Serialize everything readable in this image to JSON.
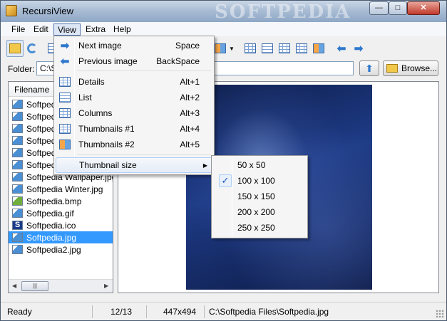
{
  "window": {
    "title": "RecursiView",
    "watermark": "SOFTPEDIA",
    "controls": {
      "minimize": "—",
      "maximize": "□",
      "close": "✕"
    }
  },
  "menubar": [
    "File",
    "Edit",
    "View",
    "Extra",
    "Help"
  ],
  "toolbar": {
    "icons": [
      "folders-icon",
      "refresh-icon",
      "thumbnail-view-icon",
      "view-options-dropdown-icon",
      "details-view-icon",
      "list-view-icon",
      "columns-view-icon",
      "thumbnails1-view-icon",
      "thumbnails2-view-icon",
      "back-arrow-icon",
      "forward-arrow-icon"
    ]
  },
  "folder": {
    "label": "Folder:",
    "value": "C:\\Softpedia Files",
    "browse_label": "Browse..."
  },
  "file_list": {
    "header": "Filename",
    "rows": [
      {
        "name": "Softpedia",
        "type": "image"
      },
      {
        "name": "Softpedia",
        "type": "image"
      },
      {
        "name": "Softpedia",
        "type": "image"
      },
      {
        "name": "Softpedia",
        "type": "image"
      },
      {
        "name": "Softpedia",
        "type": "image"
      },
      {
        "name": "Softpedia",
        "type": "image"
      },
      {
        "name": "Softpedia Wallpaper.jpg",
        "type": "image"
      },
      {
        "name": "Softpedia Winter.jpg",
        "type": "image"
      },
      {
        "name": "Softpedia.bmp",
        "type": "bmp"
      },
      {
        "name": "Softpedia.gif",
        "type": "image"
      },
      {
        "name": "Softpedia.ico",
        "type": "ico"
      },
      {
        "name": "Softpedia.jpg",
        "type": "image",
        "selected": true
      },
      {
        "name": "Softpedia2.jpg",
        "type": "image"
      }
    ],
    "ico_glyph": "S"
  },
  "view_menu": {
    "items": [
      {
        "label": "Next image",
        "shortcut": "Space",
        "icon": "arrow-right-icon"
      },
      {
        "label": "Previous image",
        "shortcut": "BackSpace",
        "icon": "arrow-left-icon"
      },
      {
        "label": "Details",
        "shortcut": "Alt+1",
        "icon": "details-view-icon"
      },
      {
        "label": "List",
        "shortcut": "Alt+2",
        "icon": "list-view-icon"
      },
      {
        "label": "Columns",
        "shortcut": "Alt+3",
        "icon": "columns-view-icon"
      },
      {
        "label": "Thumbnails #1",
        "shortcut": "Alt+4",
        "icon": "thumbnails1-view-icon"
      },
      {
        "label": "Thumbnails #2",
        "shortcut": "Alt+5",
        "icon": "thumbnails2-view-icon"
      },
      {
        "label": "Thumbnail size",
        "shortcut": "",
        "icon": ""
      }
    ]
  },
  "thumbnail_size_menu": {
    "items": [
      "50 x 50",
      "100 x 100",
      "150 x 150",
      "200 x 200",
      "250 x 250"
    ],
    "checked_index": 1,
    "check_glyph": "✓"
  },
  "statusbar": {
    "status": "Ready",
    "position": "12/13",
    "dimensions": "447x494",
    "path": "C:\\Softpedia Files\\Softpedia.jpg"
  },
  "colors": {
    "selection": "#3399ff",
    "accent_icon": "#2f78cc"
  }
}
